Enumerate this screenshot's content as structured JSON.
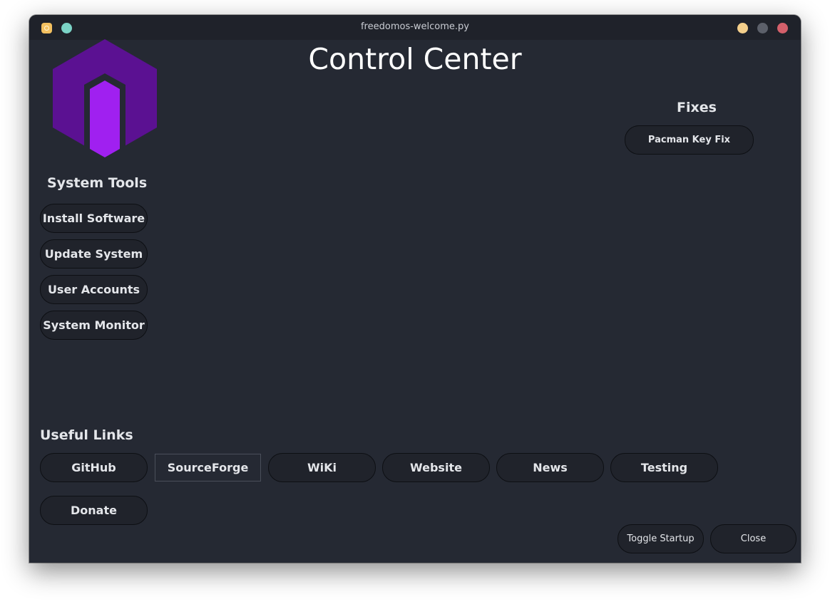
{
  "window": {
    "title": "freedomos-welcome.py"
  },
  "colors": {
    "logo_primary": "#5b1192",
    "logo_accent": "#a020f0",
    "window_bg": "#252933",
    "titlebar_bg": "#1f222a"
  },
  "header": {
    "title": "Control Center"
  },
  "fixes": {
    "heading": "Fixes",
    "buttons": [
      "Pacman Key Fix"
    ]
  },
  "system_tools": {
    "heading": "System Tools",
    "buttons": [
      "Install Software",
      "Update System",
      "User Accounts",
      "System Monitor"
    ]
  },
  "useful_links": {
    "heading": "Useful Links",
    "buttons": [
      "GitHub",
      "SourceForge",
      "WiKi",
      "Website",
      "News",
      "Testing",
      "Donate"
    ]
  },
  "footer": {
    "toggle_startup": "Toggle Startup",
    "close": "Close"
  }
}
